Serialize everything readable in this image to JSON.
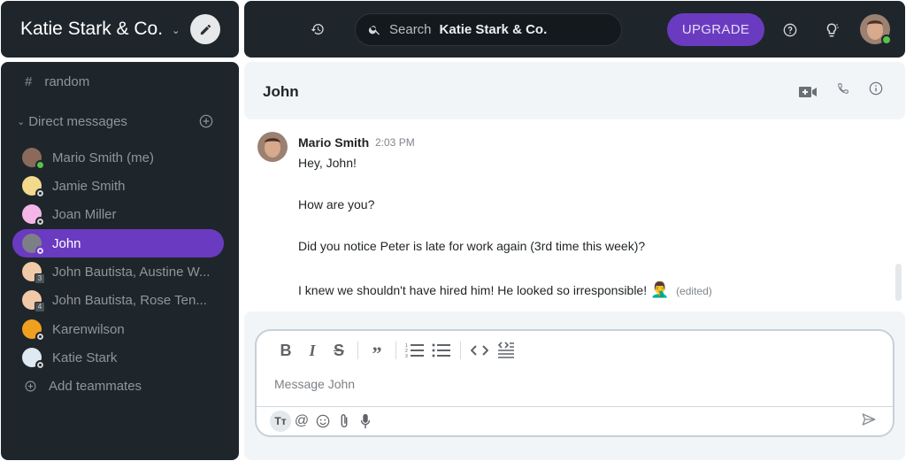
{
  "workspace": {
    "name": "Katie Stark & Co.",
    "chevron_icon": "chevron-down-icon",
    "edit_icon": "pencil-icon"
  },
  "topbar": {
    "history_icon": "history-icon",
    "search": {
      "label": "Search",
      "scope": "Katie Stark & Co."
    },
    "upgrade_label": "UPGRADE",
    "help_icon": "help-circle-icon",
    "tips_icon": "lightbulb-icon",
    "user_status": "online"
  },
  "sidebar": {
    "channels": [
      {
        "prefix": "#",
        "name": "random"
      }
    ],
    "dm_section": {
      "label": "Direct messages",
      "add_icon": "plus-circle-icon"
    },
    "dms": [
      {
        "name": "Mario Smith (me)",
        "status": "online",
        "avatar_color": "#8a6a5a"
      },
      {
        "name": "Jamie Smith",
        "status": "away",
        "avatar_color": "#f2d98c"
      },
      {
        "name": "Joan Miller",
        "status": "away",
        "avatar_color": "#f4b6e6"
      },
      {
        "name": "John",
        "status": "away",
        "avatar_color": "#7d7f86",
        "active": true
      },
      {
        "name": "John Bautista, Austine W...",
        "group_count": "3",
        "avatar_color": "#f0c9a8"
      },
      {
        "name": "John Bautista, Rose Ten...",
        "group_count": "4",
        "avatar_color": "#f0c9a8"
      },
      {
        "name": "Karenwilson",
        "status": "away",
        "avatar_color": "#f0a020"
      },
      {
        "name": "Katie Stark",
        "status": "away",
        "avatar_color": "#dfe9f2"
      }
    ],
    "add_teammates": "Add teammates"
  },
  "conversation": {
    "title": "John",
    "actions": [
      "video-call-icon",
      "phone-icon",
      "info-icon"
    ],
    "message": {
      "author": "Mario Smith",
      "time": "2:03 PM",
      "lines": [
        "Hey, John!",
        "How are you?",
        "Did you notice Peter is late for work again (3rd time this week)?",
        "I knew we shouldn't have hired him! He looked so irresponsible!"
      ],
      "emoji": "🤦‍♂️",
      "edited_label": "(edited)"
    }
  },
  "composer": {
    "placeholder": "Message John",
    "format_tools": [
      "bold",
      "italic",
      "strikethrough",
      "quote",
      "ordered-list",
      "bullet-list",
      "code",
      "code-block"
    ],
    "bottom_tools": [
      "text-format",
      "mention",
      "emoji",
      "attachment",
      "microphone"
    ],
    "tt_label": "Tт"
  }
}
